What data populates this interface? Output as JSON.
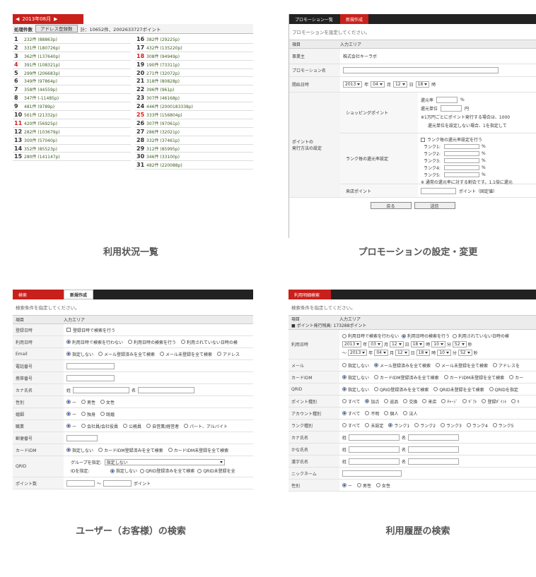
{
  "captions": {
    "p1": "利用状況一覧",
    "p2": "プロモーションの設定・変更",
    "p3": "ユーザー（お客様）の検索",
    "p4": "利用履歴の検索"
  },
  "p1": {
    "month": "2013年08月",
    "prev_icon": "◀",
    "next_icon": "▶",
    "count_label": "処理件数",
    "address_button": "アドレス登録数",
    "total": "計：10652件、2002633727ポイント",
    "left": [
      {
        "d": "1",
        "v": "232件 (88863p)",
        "red": false
      },
      {
        "d": "2",
        "v": "331件 (180726p)",
        "red": false
      },
      {
        "d": "3",
        "v": "362件 (137640p)",
        "red": false
      },
      {
        "d": "4",
        "v": "391件 (108321p)",
        "red": true
      },
      {
        "d": "5",
        "v": "299件 (206683p)",
        "red": false
      },
      {
        "d": "6",
        "v": "349件 (97864p)",
        "red": false
      },
      {
        "d": "7",
        "v": "358件 (44559p)",
        "red": false
      },
      {
        "d": "8",
        "v": "347件 (-11485p)",
        "red": false
      },
      {
        "d": "9",
        "v": "481件 (9789p)",
        "red": false
      },
      {
        "d": "10",
        "v": "561件 (21332p)",
        "red": false
      },
      {
        "d": "11",
        "v": "420件 (56925p)",
        "red": true
      },
      {
        "d": "12",
        "v": "282件 (103679p)",
        "red": false
      },
      {
        "d": "13",
        "v": "300件 (57040p)",
        "red": false
      },
      {
        "d": "14",
        "v": "352件 (85523p)",
        "red": false
      },
      {
        "d": "15",
        "v": "280件 (141147p)",
        "red": false
      }
    ],
    "right": [
      {
        "d": "16",
        "v": "382件 (29225p)",
        "red": false
      },
      {
        "d": "17",
        "v": "432件 (135220p)",
        "red": false
      },
      {
        "d": "18",
        "v": "308件 (94949p)",
        "red": true
      },
      {
        "d": "19",
        "v": "190件 (73311p)",
        "red": false
      },
      {
        "d": "20",
        "v": "271件 (32072p)",
        "red": false
      },
      {
        "d": "21",
        "v": "318件 (80828p)",
        "red": false
      },
      {
        "d": "22",
        "v": "396件 (961p)",
        "red": false
      },
      {
        "d": "23",
        "v": "307件 (46168p)",
        "red": false
      },
      {
        "d": "24",
        "v": "446件 (2000183338p)",
        "red": false
      },
      {
        "d": "25",
        "v": "333件 (156804p)",
        "red": true
      },
      {
        "d": "26",
        "v": "307件 (97061p)",
        "red": false
      },
      {
        "d": "27",
        "v": "286件 (32021p)",
        "red": false
      },
      {
        "d": "28",
        "v": "332件 (37461p)",
        "red": false
      },
      {
        "d": "29",
        "v": "312件 (85995p)",
        "red": false
      },
      {
        "d": "30",
        "v": "346件 (33100p)",
        "red": false
      },
      {
        "d": "31",
        "v": "482件 (220088p)",
        "red": false
      }
    ]
  },
  "p2": {
    "tabs": [
      "プロモーション一覧",
      "新規作成"
    ],
    "instruction": "プロモーションを設定してください。",
    "col_item": "項目",
    "col_input": "入力エリア",
    "business_label": "事業主",
    "business_value": "株式会社キーラボ",
    "name_label": "プロモーション名",
    "start_label": "開始日時",
    "start": {
      "year": "2013",
      "year_unit": "年",
      "month": "04",
      "month_unit": "月",
      "day": "12",
      "day_unit": "日",
      "hour": "18",
      "hour_unit": "時"
    },
    "method_label_1": "ポイントの",
    "method_label_2": "発行方法の設定",
    "shopping_label": "ショッピングポイント",
    "rate_label": "還元率",
    "rate_unit": "%",
    "unit_label": "還元単位",
    "unit_unit": "円",
    "note1": "※1万円ごとにポイント発行する場合は、1000",
    "note2": "還元単位を設定しない場合、1を指定して",
    "rank_label": "ランク毎の還元率設定",
    "rank_check": "ランク毎の還元率設定を行う",
    "ranks": [
      "ランク1:",
      "ランク2:",
      "ランク3:",
      "ランク4:",
      "ランク5:"
    ],
    "rank_unit": "%",
    "rank_note": "※ 通常の還元率に対する割合です。1.1倍に還元",
    "visit_label": "来店ポイント",
    "visit_suffix": "ポイント（固定値）",
    "back": "戻る",
    "submit": "送信"
  },
  "p3": {
    "tabs": [
      "検索",
      "新規作成"
    ],
    "instruction": "検索条件を指定してください。",
    "col_item": "項目",
    "col_input": "入力エリア",
    "rows": {
      "reg_label": "登録日時",
      "reg_check": "登録日時で検索を行う",
      "use_label": "利用日時",
      "use_opts": [
        "利用日時で検索を行わない",
        "利用日時の検索を行う",
        "利用されていない日時の検"
      ],
      "email_label": "Email",
      "email_opts": [
        "指定しない",
        "メール登録済みを全て検索",
        "メール未登録を全て検索",
        "アドレス"
      ],
      "tel_label": "電話番号",
      "mobile_label": "携帯番号",
      "kana_label": "カナ氏名",
      "sei": "姓",
      "mei": "名",
      "gender_label": "性別",
      "gender_opts": [
        "ー",
        "男性",
        "女性"
      ],
      "marital_label": "婚姻",
      "marital_opts": [
        "ー",
        "独身",
        "既婚"
      ],
      "job_label": "職業",
      "job_opts": [
        "ー",
        "会社員/会社役員",
        "公務員",
        "自営業/経営者",
        "パート、アルバイト"
      ],
      "zip_label": "郵便番号",
      "card_label": "カードIDM",
      "card_opts": [
        "指定しない",
        "カードIDM登録済みを全て検索",
        "カードIDM未登録を全て検索"
      ],
      "qr_label": "QRID",
      "group_label": "グループを指定:",
      "group_value": "指定しない",
      "idspec_label": "IDを指定:",
      "qr_opts": [
        "指定しない",
        "QRID登録済みを全て検索",
        "QRID未登録を全"
      ],
      "points_label": "ポイント数",
      "points_tilde": "〜",
      "points_unit": "ポイント"
    }
  },
  "p4": {
    "tabs": [
      "利用明細検索"
    ],
    "instruction": "検索条件を指定してください。",
    "col_item": "項目",
    "col_input": "入力エリア",
    "total": "■ ポイント発行残高: 173288ポイント",
    "use_label": "利用日時",
    "use_opts": [
      "利用日時で検索を行わない",
      "利用日時の検索を行う",
      "利用されていない日時の検"
    ],
    "from": {
      "y": "2013",
      "yu": "年",
      "mo": "03",
      "mou": "月",
      "d": "12",
      "du": "日",
      "h": "18",
      "hu": "時",
      "mi": "10",
      "miu": "分",
      "s": "52",
      "su": "秒"
    },
    "to_prefix": "〜",
    "to": {
      "y": "2013",
      "yu": "年",
      "mo": "04",
      "mou": "月",
      "d": "12",
      "du": "日",
      "h": "18",
      "hu": "時",
      "mi": "10",
      "miu": "分",
      "s": "52",
      "su": "秒"
    },
    "mail_label": "メール",
    "mail_opts": [
      "指定しない",
      "メール登録済みを全て検索",
      "メール未登録を全て検索",
      "アドレスを"
    ],
    "card_label": "カードIDM",
    "card_opts": [
      "指定しない",
      "カードIDM登録済みを全て検索",
      "カードIDM未登録を全て検索",
      "カー"
    ],
    "qr_label": "QRID",
    "qr_opts": [
      "指定しない",
      "QRID登録済みを全て検索",
      "QRID未登録を全て検索",
      "QRIDを指定"
    ],
    "ptype_label": "ポイント種別",
    "ptype_opts": [
      "すべて",
      "加点",
      "返品",
      "交換",
      "来店",
      "ﾁｬｰｼﾞ",
      "ｷﾞﾌﾄ",
      "登録ﾎﾞｲﾝﾄ",
      "ｷ"
    ],
    "acct_label": "アカウント種別",
    "acct_opts": [
      "すべて",
      "不明",
      "個人",
      "法人"
    ],
    "rank_label": "ランク種別",
    "rank_opts": [
      "すべて",
      "未設定",
      "ランク1",
      "ランク2",
      "ランク3",
      "ランク4",
      "ランク5"
    ],
    "kana_label": "カナ氏名",
    "hira_label": "かな氏名",
    "kanji_label": "漢字氏名",
    "sei": "姓",
    "mei": "名",
    "nick_label": "ニックネーム",
    "gender_label": "性別",
    "gender_opts": [
      "ー",
      "男性",
      "女性"
    ]
  }
}
